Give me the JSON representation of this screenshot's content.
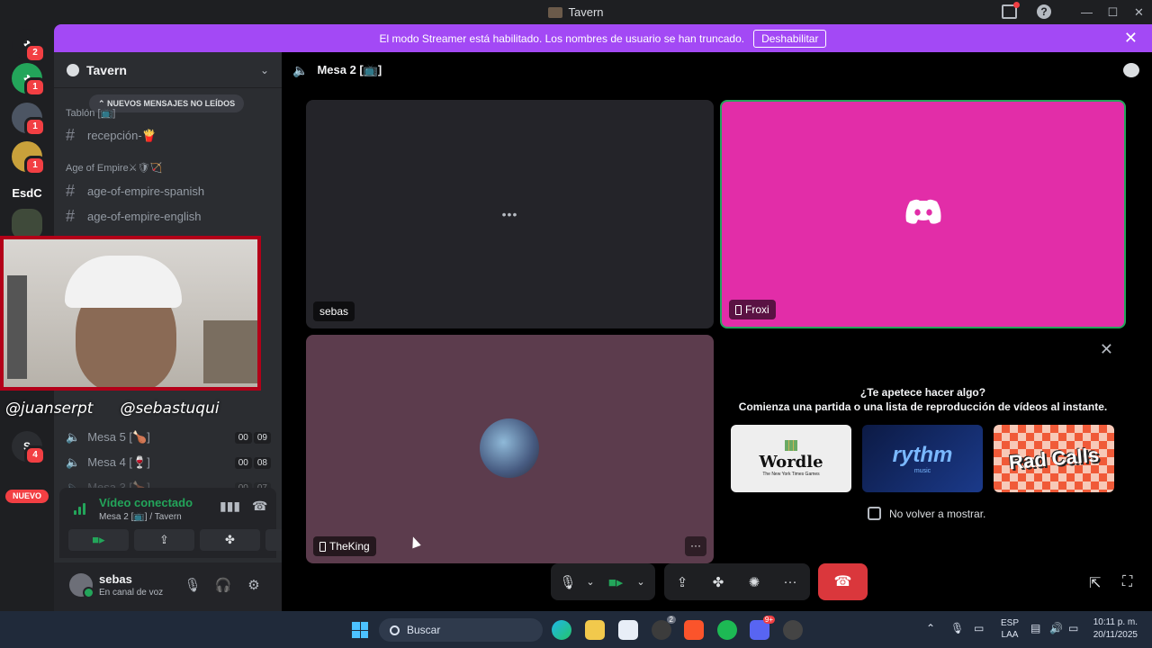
{
  "window": {
    "title": "Tavern"
  },
  "banner": {
    "text": "El modo Streamer está habilitado. Los nombres de usuario se han truncado.",
    "button": "Deshabilitar"
  },
  "rail": {
    "badges": [
      "2",
      "1",
      "1",
      "1",
      "4"
    ],
    "esdc_label": "EsdC",
    "s_label": "S",
    "new_label": "NUEVO"
  },
  "sidebar": {
    "guild_name": "Tavern",
    "unread_pill": "NUEVOS MENSAJES NO LEÍDOS",
    "category_1": "Tablón [📺]",
    "channel_1": "recepción-🍟",
    "category_2": "Age of Empire⚔🛡🏹",
    "channel_2": "age-of-empire-spanish",
    "channel_3": "age-of-empire-english",
    "voice_channels": [
      {
        "name": "Mesa 5 [🍗]",
        "count_a": "00",
        "count_b": "09"
      },
      {
        "name": "Mesa 4 [🍷]",
        "count_a": "00",
        "count_b": "08"
      },
      {
        "name": "Mesa 3 [🍗]",
        "count_a": "00",
        "count_b": "07"
      }
    ]
  },
  "webcam": {
    "handle_left": "@juanserpt",
    "handle_right": "@sebastuqui"
  },
  "voice": {
    "status": "Vídeo conectado",
    "location": "Mesa 2 [📺] / Tavern"
  },
  "user": {
    "name": "sebas",
    "status": "En canal de voz"
  },
  "call": {
    "channel_name": "Mesa 2 [📺]",
    "tiles": {
      "tile1_name": "sebas",
      "tile1_dots": "•••",
      "tile2_name": "Froxi",
      "tile3_name": "TheKing",
      "tile3_more": "···"
    }
  },
  "activity": {
    "question": "¿Te apetece hacer algo?",
    "subtitle": "Comienza una partida o una lista de reproducción de vídeos al instante.",
    "cards": [
      {
        "title": "Wordle",
        "sub": "The New York Times Games"
      },
      {
        "title": "rythm",
        "sub": "music"
      },
      {
        "title": "Rad Calls"
      }
    ],
    "checkbox_label": "No volver a mostrar."
  },
  "taskbar": {
    "search_placeholder": "Buscar",
    "lang_1": "ESP",
    "lang_2": "LAA",
    "time": "10:11 p. m.",
    "date": "20/11/2025",
    "xbox_badge": "2",
    "discord_badge": "9+"
  },
  "colors": {
    "streamer_purple": "#a349f5",
    "froxi_pink": "#e22da8",
    "connected_green": "#23a55a",
    "hangup_red": "#da373c"
  }
}
